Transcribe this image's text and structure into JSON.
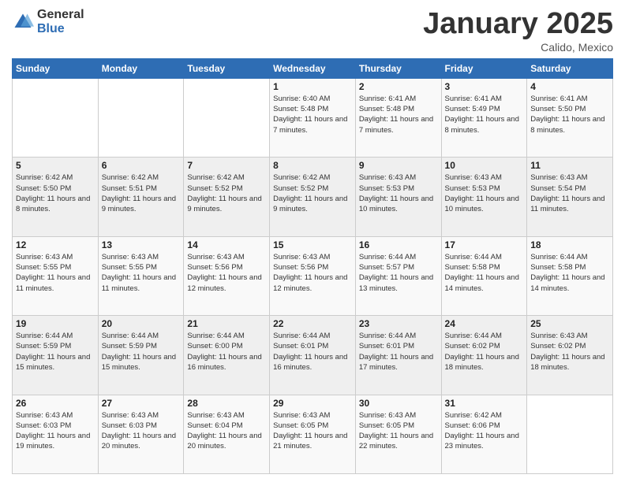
{
  "logo": {
    "general": "General",
    "blue": "Blue"
  },
  "header": {
    "month": "January 2025",
    "location": "Calido, Mexico"
  },
  "weekdays": [
    "Sunday",
    "Monday",
    "Tuesday",
    "Wednesday",
    "Thursday",
    "Friday",
    "Saturday"
  ],
  "weeks": [
    [
      {
        "day": "",
        "sunrise": "",
        "sunset": "",
        "daylight": ""
      },
      {
        "day": "",
        "sunrise": "",
        "sunset": "",
        "daylight": ""
      },
      {
        "day": "",
        "sunrise": "",
        "sunset": "",
        "daylight": ""
      },
      {
        "day": "1",
        "sunrise": "Sunrise: 6:40 AM",
        "sunset": "Sunset: 5:48 PM",
        "daylight": "Daylight: 11 hours and 7 minutes."
      },
      {
        "day": "2",
        "sunrise": "Sunrise: 6:41 AM",
        "sunset": "Sunset: 5:48 PM",
        "daylight": "Daylight: 11 hours and 7 minutes."
      },
      {
        "day": "3",
        "sunrise": "Sunrise: 6:41 AM",
        "sunset": "Sunset: 5:49 PM",
        "daylight": "Daylight: 11 hours and 8 minutes."
      },
      {
        "day": "4",
        "sunrise": "Sunrise: 6:41 AM",
        "sunset": "Sunset: 5:50 PM",
        "daylight": "Daylight: 11 hours and 8 minutes."
      }
    ],
    [
      {
        "day": "5",
        "sunrise": "Sunrise: 6:42 AM",
        "sunset": "Sunset: 5:50 PM",
        "daylight": "Daylight: 11 hours and 8 minutes."
      },
      {
        "day": "6",
        "sunrise": "Sunrise: 6:42 AM",
        "sunset": "Sunset: 5:51 PM",
        "daylight": "Daylight: 11 hours and 9 minutes."
      },
      {
        "day": "7",
        "sunrise": "Sunrise: 6:42 AM",
        "sunset": "Sunset: 5:52 PM",
        "daylight": "Daylight: 11 hours and 9 minutes."
      },
      {
        "day": "8",
        "sunrise": "Sunrise: 6:42 AM",
        "sunset": "Sunset: 5:52 PM",
        "daylight": "Daylight: 11 hours and 9 minutes."
      },
      {
        "day": "9",
        "sunrise": "Sunrise: 6:43 AM",
        "sunset": "Sunset: 5:53 PM",
        "daylight": "Daylight: 11 hours and 10 minutes."
      },
      {
        "day": "10",
        "sunrise": "Sunrise: 6:43 AM",
        "sunset": "Sunset: 5:53 PM",
        "daylight": "Daylight: 11 hours and 10 minutes."
      },
      {
        "day": "11",
        "sunrise": "Sunrise: 6:43 AM",
        "sunset": "Sunset: 5:54 PM",
        "daylight": "Daylight: 11 hours and 11 minutes."
      }
    ],
    [
      {
        "day": "12",
        "sunrise": "Sunrise: 6:43 AM",
        "sunset": "Sunset: 5:55 PM",
        "daylight": "Daylight: 11 hours and 11 minutes."
      },
      {
        "day": "13",
        "sunrise": "Sunrise: 6:43 AM",
        "sunset": "Sunset: 5:55 PM",
        "daylight": "Daylight: 11 hours and 11 minutes."
      },
      {
        "day": "14",
        "sunrise": "Sunrise: 6:43 AM",
        "sunset": "Sunset: 5:56 PM",
        "daylight": "Daylight: 11 hours and 12 minutes."
      },
      {
        "day": "15",
        "sunrise": "Sunrise: 6:43 AM",
        "sunset": "Sunset: 5:56 PM",
        "daylight": "Daylight: 11 hours and 12 minutes."
      },
      {
        "day": "16",
        "sunrise": "Sunrise: 6:44 AM",
        "sunset": "Sunset: 5:57 PM",
        "daylight": "Daylight: 11 hours and 13 minutes."
      },
      {
        "day": "17",
        "sunrise": "Sunrise: 6:44 AM",
        "sunset": "Sunset: 5:58 PM",
        "daylight": "Daylight: 11 hours and 14 minutes."
      },
      {
        "day": "18",
        "sunrise": "Sunrise: 6:44 AM",
        "sunset": "Sunset: 5:58 PM",
        "daylight": "Daylight: 11 hours and 14 minutes."
      }
    ],
    [
      {
        "day": "19",
        "sunrise": "Sunrise: 6:44 AM",
        "sunset": "Sunset: 5:59 PM",
        "daylight": "Daylight: 11 hours and 15 minutes."
      },
      {
        "day": "20",
        "sunrise": "Sunrise: 6:44 AM",
        "sunset": "Sunset: 5:59 PM",
        "daylight": "Daylight: 11 hours and 15 minutes."
      },
      {
        "day": "21",
        "sunrise": "Sunrise: 6:44 AM",
        "sunset": "Sunset: 6:00 PM",
        "daylight": "Daylight: 11 hours and 16 minutes."
      },
      {
        "day": "22",
        "sunrise": "Sunrise: 6:44 AM",
        "sunset": "Sunset: 6:01 PM",
        "daylight": "Daylight: 11 hours and 16 minutes."
      },
      {
        "day": "23",
        "sunrise": "Sunrise: 6:44 AM",
        "sunset": "Sunset: 6:01 PM",
        "daylight": "Daylight: 11 hours and 17 minutes."
      },
      {
        "day": "24",
        "sunrise": "Sunrise: 6:44 AM",
        "sunset": "Sunset: 6:02 PM",
        "daylight": "Daylight: 11 hours and 18 minutes."
      },
      {
        "day": "25",
        "sunrise": "Sunrise: 6:43 AM",
        "sunset": "Sunset: 6:02 PM",
        "daylight": "Daylight: 11 hours and 18 minutes."
      }
    ],
    [
      {
        "day": "26",
        "sunrise": "Sunrise: 6:43 AM",
        "sunset": "Sunset: 6:03 PM",
        "daylight": "Daylight: 11 hours and 19 minutes."
      },
      {
        "day": "27",
        "sunrise": "Sunrise: 6:43 AM",
        "sunset": "Sunset: 6:03 PM",
        "daylight": "Daylight: 11 hours and 20 minutes."
      },
      {
        "day": "28",
        "sunrise": "Sunrise: 6:43 AM",
        "sunset": "Sunset: 6:04 PM",
        "daylight": "Daylight: 11 hours and 20 minutes."
      },
      {
        "day": "29",
        "sunrise": "Sunrise: 6:43 AM",
        "sunset": "Sunset: 6:05 PM",
        "daylight": "Daylight: 11 hours and 21 minutes."
      },
      {
        "day": "30",
        "sunrise": "Sunrise: 6:43 AM",
        "sunset": "Sunset: 6:05 PM",
        "daylight": "Daylight: 11 hours and 22 minutes."
      },
      {
        "day": "31",
        "sunrise": "Sunrise: 6:42 AM",
        "sunset": "Sunset: 6:06 PM",
        "daylight": "Daylight: 11 hours and 23 minutes."
      },
      {
        "day": "",
        "sunrise": "",
        "sunset": "",
        "daylight": ""
      }
    ]
  ]
}
